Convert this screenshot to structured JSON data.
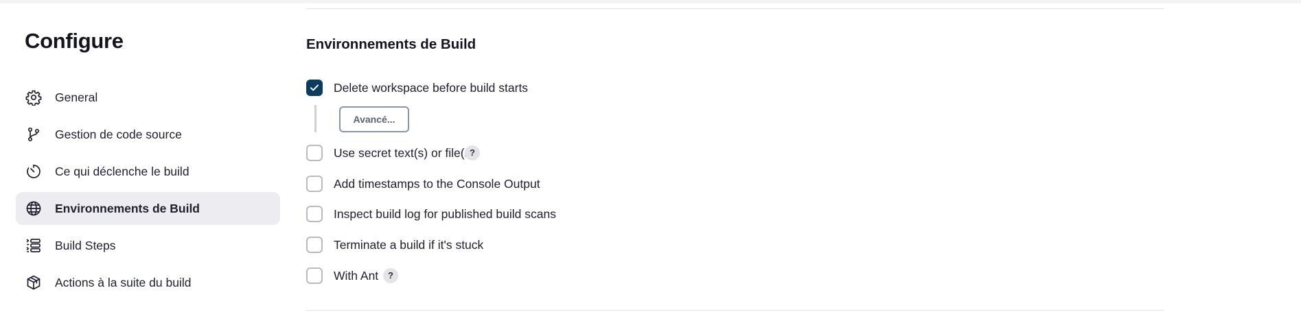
{
  "sidebar": {
    "title": "Configure",
    "items": [
      {
        "label": "General",
        "icon": "gear-icon"
      },
      {
        "label": "Gestion de code source",
        "icon": "branch-icon"
      },
      {
        "label": "Ce qui déclenche le build",
        "icon": "timer-icon"
      },
      {
        "label": "Environnements de Build",
        "icon": "globe-icon",
        "active": true
      },
      {
        "label": "Build Steps",
        "icon": "list-steps-icon"
      },
      {
        "label": "Actions à la suite du build",
        "icon": "package-icon"
      }
    ]
  },
  "main": {
    "section_title": "Environnements de Build",
    "options": [
      {
        "label": "Delete workspace before build starts",
        "checked": true
      },
      {
        "label": "Use secret text(s) or file(s)",
        "checked": false,
        "help": "?"
      },
      {
        "label": "Add timestamps to the Console Output",
        "checked": false
      },
      {
        "label": "Inspect build log for published build scans",
        "checked": false
      },
      {
        "label": "Terminate a build if it's stuck",
        "checked": false
      },
      {
        "label": "With Ant",
        "checked": false,
        "help": "?"
      }
    ],
    "advanced_button": "Avancé..."
  },
  "colors": {
    "checkbox_checked": "#0c3c5e",
    "active_nav_bg": "#ececf1",
    "help_badge_bg": "#e3e3e8"
  }
}
